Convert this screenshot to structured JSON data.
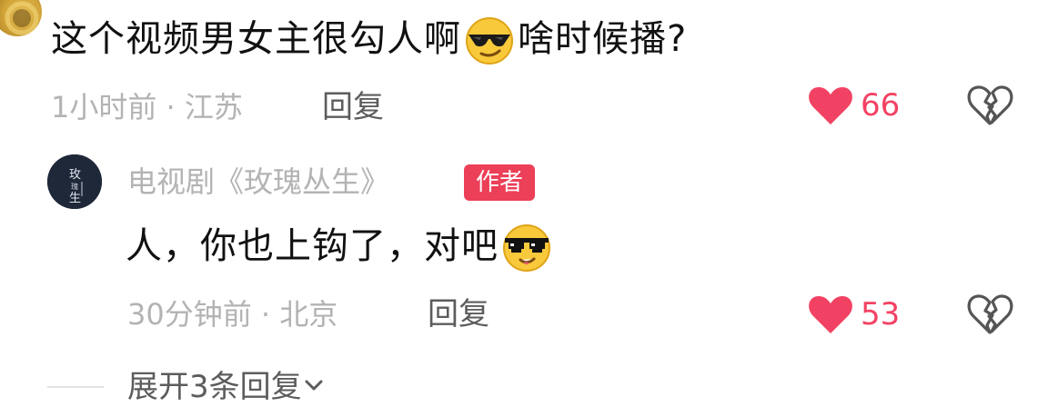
{
  "comment": {
    "text_before_emoji": "这个视频男女主很勾人啊",
    "emoji": "cool-sunglasses-emoji",
    "text_after_emoji": "啥时候播?",
    "time_location": "1小时前 · 江苏",
    "reply_label": "回复",
    "like_count": "66"
  },
  "reply": {
    "author_name": "电视剧《玫瑰丛生》",
    "author_badge": "作者",
    "avatar_text": "玫瑰丛生",
    "text": "人，你也上钩了，对吧",
    "emoji": "pixel-sunglasses-emoji",
    "time_location": "30分钟前 · 北京",
    "reply_label": "回复",
    "like_count": "53"
  },
  "expand": {
    "label": "展开3条回复"
  },
  "colors": {
    "like_red": "#f24263",
    "badge_red": "#ec3f58",
    "meta_gray": "#b3b3b3",
    "text_dark": "#111111"
  }
}
